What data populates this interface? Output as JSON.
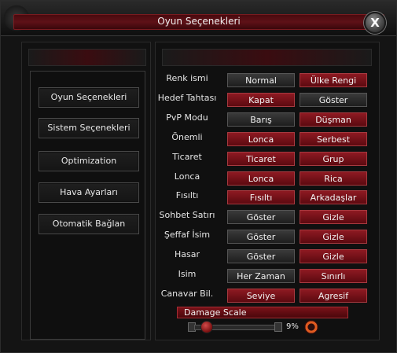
{
  "window": {
    "title": "Oyun Seçenekleri",
    "close_label": "X"
  },
  "sidebar": {
    "items": [
      {
        "label": "Oyun Seçenekleri"
      },
      {
        "label": "Sistem Seçenekleri"
      },
      {
        "label": "Optimization"
      },
      {
        "label": "Hava Ayarları"
      },
      {
        "label": "Otomatik Bağlan"
      }
    ]
  },
  "options": {
    "rows": [
      {
        "label": "Renk ismi",
        "opt1": "Normal",
        "opt2": "Ülke Rengi"
      },
      {
        "label": "Hedef Tahtası",
        "opt1": "Kapat",
        "opt2": "Göster"
      },
      {
        "label": "PvP Modu",
        "opt1": "Barış",
        "opt2": "Düşman"
      },
      {
        "label": "Önemli",
        "opt1": "Lonca",
        "opt2": "Serbest"
      },
      {
        "label": "Ticaret",
        "opt1": "Ticaret",
        "opt2": "Grup"
      },
      {
        "label": "Lonca",
        "opt1": "Lonca",
        "opt2": "Rica"
      },
      {
        "label": "Fısıltı",
        "opt1": "Fısıltı",
        "opt2": "Arkadaşlar"
      },
      {
        "label": "Sohbet Satırı",
        "opt1": "Göster",
        "opt2": "Gizle"
      },
      {
        "label": "Şeffaf İsim",
        "opt1": "Göster",
        "opt2": "Gizle"
      },
      {
        "label": "Hasar",
        "opt1": "Göster",
        "opt2": "Gizle"
      },
      {
        "label": "Isim",
        "opt1": "Her Zaman",
        "opt2": "Sınırlı"
      },
      {
        "label": "Canavar Bil.",
        "opt1": "Seviye",
        "opt2": "Agresif"
      }
    ]
  },
  "damage": {
    "label": "Damage Scale",
    "percent_text": "9%",
    "level_fraction": 0.09
  },
  "icons": {
    "close": "close-icon",
    "slider_thumb": "slider-thumb-icon",
    "reset": "reset-icon"
  },
  "colors": {
    "accent_red": "#8e1a22",
    "button_gray": "#2e2e2e"
  }
}
